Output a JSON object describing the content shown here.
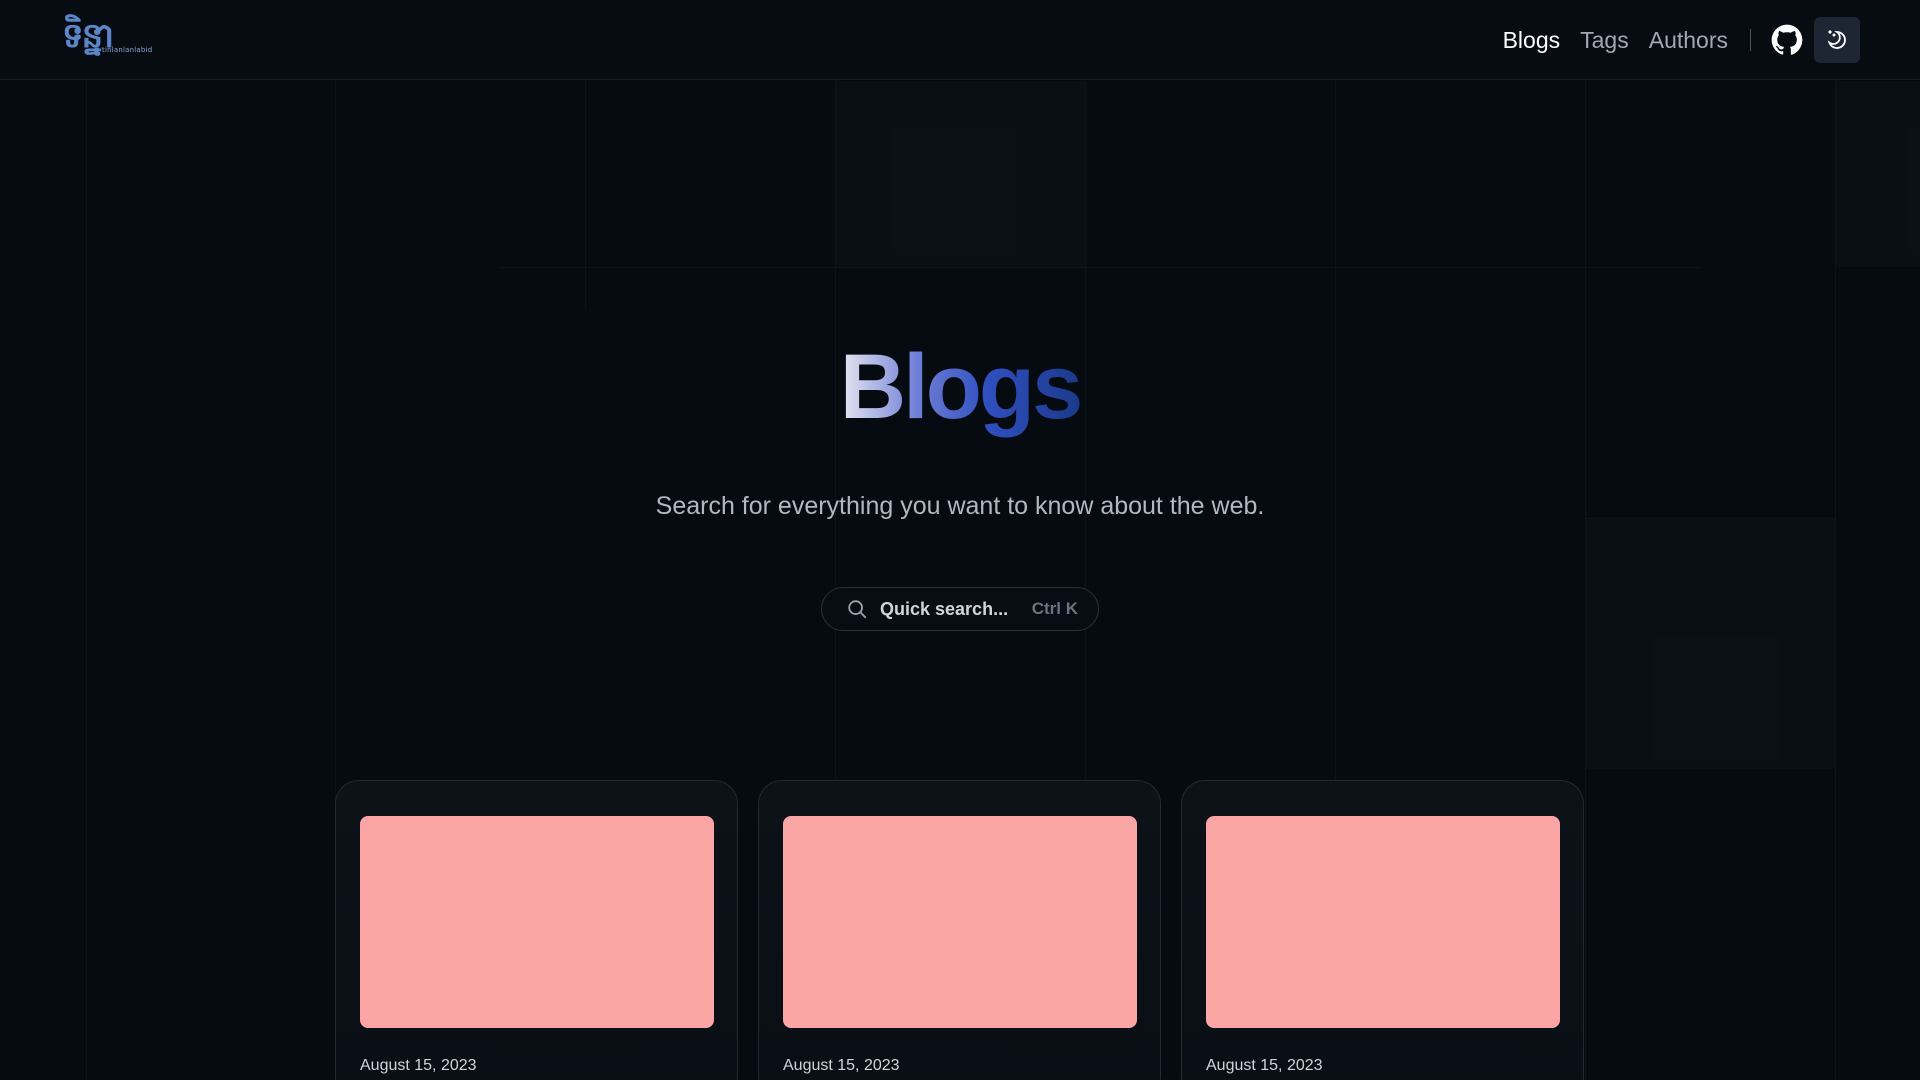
{
  "brand": {
    "logo_text": "ទិន្នា",
    "logo_subtext": "tinlanlanlabid"
  },
  "nav": {
    "items": [
      {
        "label": "Blogs",
        "active": true
      },
      {
        "label": "Tags",
        "active": false
      },
      {
        "label": "Authors",
        "active": false
      }
    ],
    "github_icon": "github-icon",
    "theme_icon": "moon-sun-icon"
  },
  "hero": {
    "title": "Blogs",
    "subtitle": "Search for everything you want to know about the web."
  },
  "search": {
    "placeholder": "Quick search...",
    "shortcut": "Ctrl K",
    "icon": "search-icon"
  },
  "posts": [
    {
      "date": "August 15, 2023",
      "thumb_color": "#fba5a4"
    },
    {
      "date": "August 15, 2023",
      "thumb_color": "#fba5a4"
    },
    {
      "date": "August 15, 2023",
      "thumb_color": "#fba5a4"
    }
  ],
  "colors": {
    "background": "#060a11",
    "title_gradient_start": "#e6e8f2",
    "title_gradient_end": "#1c3a8a",
    "card_thumbnail": "#fba5a4"
  }
}
